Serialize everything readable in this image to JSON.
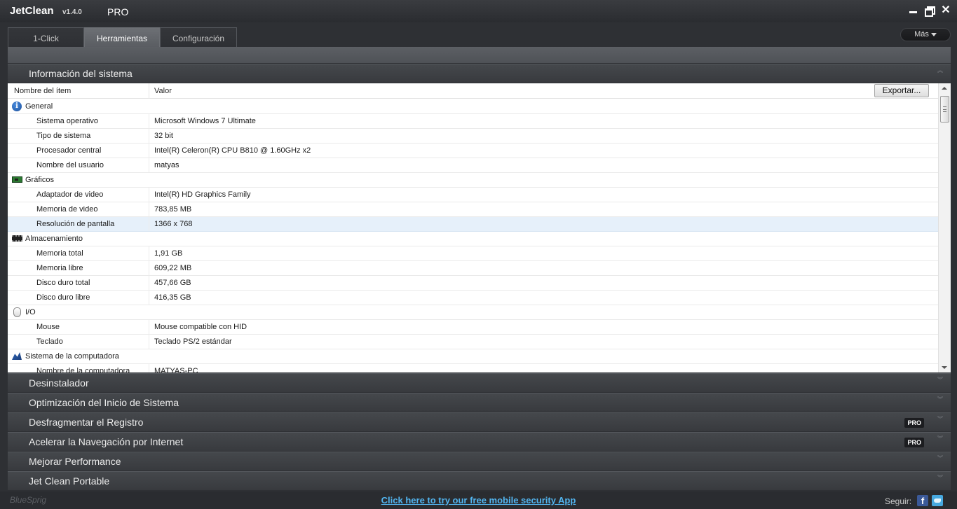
{
  "titlebar": {
    "app_name": "JetClean",
    "version": "v1.4.0",
    "edition": "PRO"
  },
  "tabs": [
    {
      "label": "1-Click",
      "active": false
    },
    {
      "label": "Herramientas",
      "active": true
    },
    {
      "label": "Configuración",
      "active": false
    }
  ],
  "more_button": {
    "label": "Más"
  },
  "system_info": {
    "title": "Información del sistema",
    "col_name": "Nombre del ítem",
    "col_value": "Valor",
    "export_label": "Exportar...",
    "rows": [
      {
        "type": "group",
        "icon": "info-icon",
        "name": "General"
      },
      {
        "type": "item",
        "name": "Sistema operativo",
        "value": "Microsoft Windows 7 Ultimate"
      },
      {
        "type": "item",
        "name": "Tipo de sistema",
        "value": "32 bit"
      },
      {
        "type": "item",
        "name": "Procesador central",
        "value": "Intel(R) Celeron(R) CPU B810 @ 1.60GHz x2"
      },
      {
        "type": "item",
        "name": "Nombre del usuario",
        "value": "matyas"
      },
      {
        "type": "group",
        "icon": "graphics-card-icon",
        "name": "Gráficos"
      },
      {
        "type": "item",
        "name": "Adaptador de video",
        "value": "Intel(R) HD Graphics Family"
      },
      {
        "type": "item",
        "name": "Memoria de video",
        "value": "783,85 MB"
      },
      {
        "type": "item",
        "name": "Resolución de pantalla",
        "value": "1366 x 768",
        "selected": true
      },
      {
        "type": "group",
        "icon": "memory-chip-icon",
        "name": "Almacenamiento"
      },
      {
        "type": "item",
        "name": "Memoria total",
        "value": "1,91 GB"
      },
      {
        "type": "item",
        "name": "Memoria libre",
        "value": "609,22 MB"
      },
      {
        "type": "item",
        "name": "Disco duro total",
        "value": "457,66 GB"
      },
      {
        "type": "item",
        "name": "Disco duro libre",
        "value": "416,35 GB"
      },
      {
        "type": "group",
        "icon": "mouse-icon",
        "name": "I/O"
      },
      {
        "type": "item",
        "name": "Mouse",
        "value": "Mouse compatible con HID"
      },
      {
        "type": "item",
        "name": "Teclado",
        "value": "Teclado PS/2 estándar"
      },
      {
        "type": "group",
        "icon": "computer-icon",
        "name": "Sistema de la computadora"
      },
      {
        "type": "item",
        "name": "Nombre de la computadora",
        "value": "MATYAS-PC"
      }
    ]
  },
  "sections": [
    {
      "title": "Desinstalador",
      "pro": false
    },
    {
      "title": "Optimización del Inicio de Sistema",
      "pro": false
    },
    {
      "title": "Desfragmentar el Registro",
      "pro": true
    },
    {
      "title": "Acelerar la Navegación por Internet",
      "pro": true
    },
    {
      "title": "Mejorar Performance",
      "pro": false
    },
    {
      "title": "Jet Clean Portable",
      "pro": false
    }
  ],
  "pro_badge_label": "PRO",
  "footer": {
    "brand": "BlueSprig",
    "promo_link": "Click here to try our free mobile security App",
    "follow_label": "Seguir:",
    "facebook_glyph": "f"
  },
  "colors": {
    "accent_link": "#52b5f0",
    "background": "#2e3034",
    "selected_row": "#e6f0fa"
  }
}
